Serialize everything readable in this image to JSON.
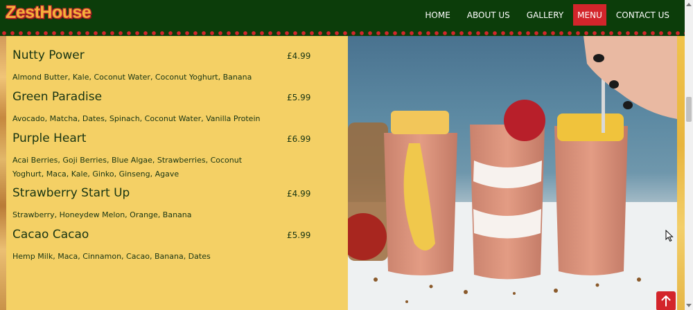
{
  "brand": {
    "logo_text": "ZestHouse"
  },
  "nav": {
    "items": [
      {
        "label": "HOME",
        "active": false
      },
      {
        "label": "ABOUT US",
        "active": false
      },
      {
        "label": "GALLERY",
        "active": false
      },
      {
        "label": "MENU",
        "active": true
      },
      {
        "label": "CONTACT US",
        "active": false
      }
    ]
  },
  "menu": {
    "items": [
      {
        "name": "Nutty Power",
        "price": "£4.99",
        "description": "Almond Butter, Kale, Coconut Water, Coconut Yoghurt, Banana"
      },
      {
        "name": "Green Paradise",
        "price": "£5.99",
        "description": "Avocado, Matcha, Dates, Spinach, Coconut Water, Vanilla Protein"
      },
      {
        "name": "Purple Heart",
        "price": "£6.99",
        "description": "Acai Berries, Goji Berries, Blue Algae, Strawberries, Coconut Yoghurt, Maca, Kale, Ginko, Ginseng, Agave"
      },
      {
        "name": "Strawberry Start Up",
        "price": "£4.99",
        "description": "Strawberry, Honeydew Melon, Orange, Banana"
      },
      {
        "name": "Cacao Cacao",
        "price": "£5.99",
        "description": "Hemp Milk, Maca, Cinnamon, Cacao, Banana, Dates"
      }
    ]
  },
  "colors": {
    "nav_bg": "#0c3d0a",
    "accent_red": "#d3252b",
    "menu_bg": "#f4d065",
    "logo_fill": "#f4b13a"
  },
  "icons": {
    "back_to_top": "arrow-up-icon"
  }
}
